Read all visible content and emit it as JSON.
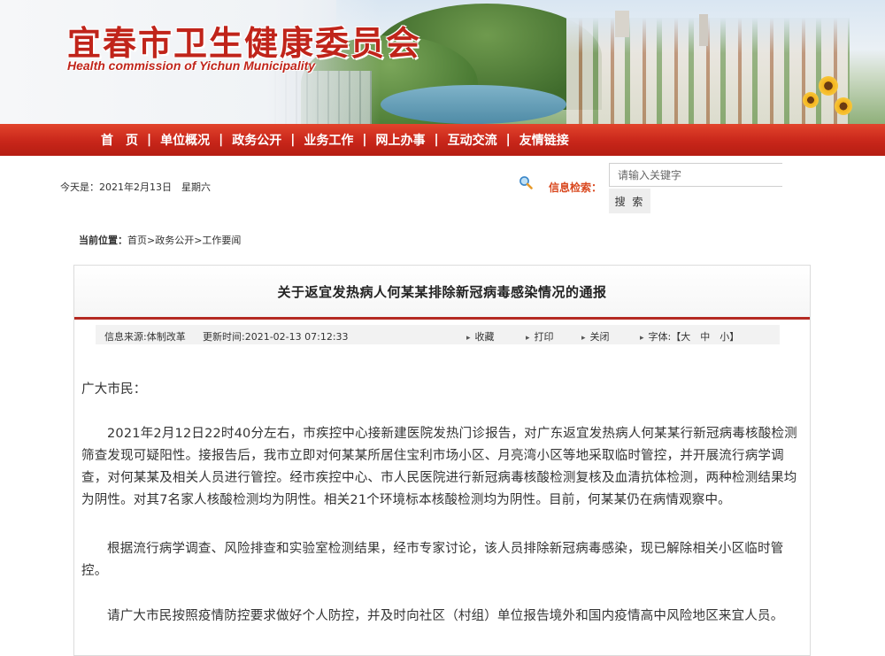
{
  "header": {
    "site_title": "宜春市卫生健康委员会",
    "site_subtitle": "Health commission of Yichun Municipality"
  },
  "nav": {
    "items": [
      "首　页",
      "单位概况",
      "政务公开",
      "业务工作",
      "网上办事",
      "互动交流",
      "友情链接"
    ],
    "separator": "|"
  },
  "info_bar": {
    "today_text": "今天是：2021年2月13日　星期六",
    "search_label": "信息检索：",
    "search_placeholder": "请输入关键字",
    "search_button": "搜 索"
  },
  "breadcrumb": {
    "label": "当前位置：",
    "path": "首页>政务公开>工作要闻"
  },
  "article": {
    "title": "关于返宜发热病人何某某排除新冠病毒感染情况的通报",
    "meta": {
      "source": "信息来源:体制改革",
      "updated": "更新时间:2021-02-13 07:12:33",
      "favorite": "收藏",
      "print": "打印",
      "close": "关闭",
      "font_size": "字体:【大　中　小】"
    },
    "paragraphs": [
      "广大市民：",
      "2021年2月12日22时40分左右，市疾控中心接新建医院发热门诊报告，对广东返宜发热病人何某某行新冠病毒核酸检测筛查发现可疑阳性。接报告后，我市立即对何某某所居住宝利市场小区、月亮湾小区等地采取临时管控，并开展流行病学调查，对何某某及相关人员进行管控。经市疾控中心、市人民医院进行新冠病毒核酸检测复核及血清抗体检测，两种检测结果均为阴性。对其7名家人核酸检测均为阴性。相关21个环境标本核酸检测均为阴性。目前，何某某仍在病情观察中。",
      "根据流行病学调查、风险排查和实验室检测结果，经市专家讨论，该人员排除新冠病毒感染，现已解除相关小区临时管控。",
      "请广大市民按照疫情防控要求做好个人防控，并及时向社区（村组）单位报告境外和国内疫情高中风险地区来宜人员。"
    ]
  },
  "colors": {
    "brand_red": "#c8261a",
    "search_label": "#d9481f",
    "title_rule": "#b52a22"
  },
  "icons": {
    "search": "magnifier-icon"
  }
}
